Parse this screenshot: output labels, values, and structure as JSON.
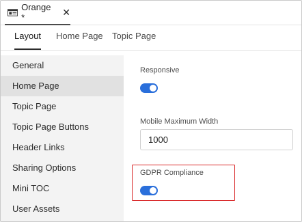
{
  "document_tab": {
    "title": "Orange *",
    "close_glyph": "✕",
    "icon": "browser-window-icon"
  },
  "tabs": [
    {
      "label": "Layout",
      "active": true
    },
    {
      "label": "Home Page",
      "active": false
    },
    {
      "label": "Topic Page",
      "active": false
    }
  ],
  "sidebar": {
    "items": [
      {
        "label": "General",
        "selected": false
      },
      {
        "label": "Home Page",
        "selected": true
      },
      {
        "label": "Topic Page",
        "selected": false
      },
      {
        "label": "Topic Page Buttons",
        "selected": false
      },
      {
        "label": "Header Links",
        "selected": false
      },
      {
        "label": "Sharing Options",
        "selected": false
      },
      {
        "label": "Mini TOC",
        "selected": false
      },
      {
        "label": "User Assets",
        "selected": false
      }
    ]
  },
  "settings": {
    "responsive": {
      "label": "Responsive",
      "on": true
    },
    "mobile_max_width": {
      "label": "Mobile Maximum Width",
      "value": "1000"
    },
    "gdpr": {
      "label": "GDPR Compliance",
      "on": true
    }
  },
  "colors": {
    "accent": "#2a6fdb",
    "highlight": "#d9292a",
    "sidebar_bg": "#f3f3f3",
    "sidebar_selected": "#e1e1e1"
  }
}
